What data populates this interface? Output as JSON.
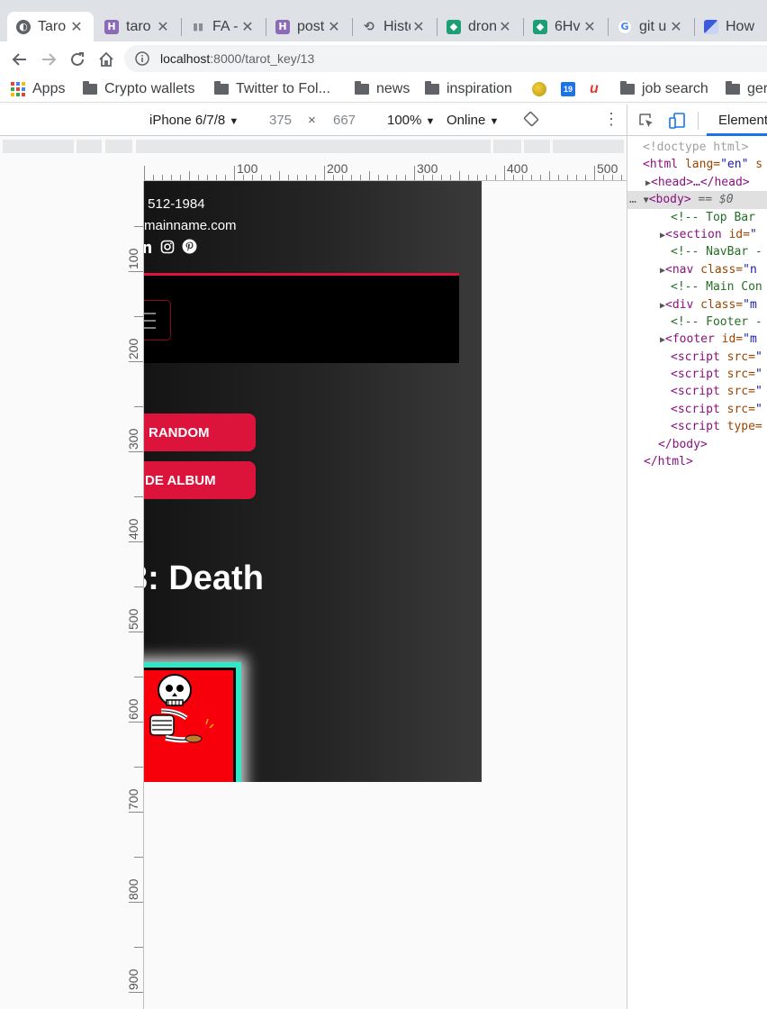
{
  "browser": {
    "tabs": [
      {
        "title": "Taro",
        "active": true,
        "icon": "globe-icon"
      },
      {
        "title": "taro",
        "active": false,
        "icon": "heroku-icon"
      },
      {
        "title": "FA -",
        "active": false,
        "icon": "bars-icon"
      },
      {
        "title": "post",
        "active": false,
        "icon": "heroku-icon"
      },
      {
        "title": "Histo",
        "active": false,
        "icon": "history-icon"
      },
      {
        "title": "dron",
        "active": false,
        "icon": "codepen-icon"
      },
      {
        "title": "6Hv",
        "active": false,
        "icon": "codepen-icon"
      },
      {
        "title": "git u",
        "active": false,
        "icon": "google-icon"
      },
      {
        "title": "How",
        "active": false,
        "icon": "bookmark-icon"
      }
    ],
    "url_host": "localhost",
    "url_path": ":8000/tarot_key/13",
    "bookmarks": [
      {
        "label": "Apps",
        "icon": "apps-icon"
      },
      {
        "label": "Crypto wallets",
        "icon": "folder-icon"
      },
      {
        "label": "Twitter to Fol...",
        "icon": "folder-icon"
      },
      {
        "label": "news",
        "icon": "folder-icon"
      },
      {
        "label": "inspiration",
        "icon": "folder-icon"
      },
      {
        "label": "",
        "icon": "ball-icon"
      },
      {
        "label": "",
        "icon": "calendar-icon"
      },
      {
        "label": "",
        "icon": "u-icon"
      },
      {
        "label": "job search",
        "icon": "folder-icon"
      },
      {
        "label": "ger",
        "icon": "folder-icon"
      }
    ]
  },
  "device_toolbar": {
    "device": "iPhone 6/7/8",
    "width": "375",
    "times": "×",
    "height": "667",
    "zoom": "100%",
    "network": "Online"
  },
  "rulers": {
    "top": [
      "100",
      "200",
      "300",
      "400",
      "500"
    ],
    "left": [
      "100",
      "200",
      "300",
      "400",
      "500",
      "600",
      "700",
      "800",
      "900"
    ]
  },
  "page": {
    "phone": ") 512-1984",
    "email": "mainname.com",
    "social_icons": [
      "linkedin-icon",
      "instagram-icon",
      "pinterest-icon"
    ],
    "buttons": [
      "RANDOM",
      "DE ALBUM"
    ],
    "heading": "3: Death",
    "colors": {
      "accent": "#dc143c",
      "card_border": "#2ee8c8",
      "card_bg": "#f8000b"
    }
  },
  "devtools": {
    "active_tab": "Element",
    "dom": [
      {
        "type": "doctype",
        "text": "<!doctype html>"
      },
      {
        "type": "tag",
        "open": "<html",
        "attr": " lang=",
        "val": "\"en\"",
        "rest": " s"
      },
      {
        "type": "collapsed",
        "text": "<head>…</head>"
      },
      {
        "type": "body",
        "text": "<body>",
        "suffix": " == $0"
      },
      {
        "type": "comment",
        "text": "<!-- Top Bar"
      },
      {
        "type": "tag",
        "open": "<section",
        "attr": " id=",
        "val": "\"",
        "rest": ""
      },
      {
        "type": "comment",
        "text": "<!-- NavBar -"
      },
      {
        "type": "tag",
        "open": "<nav",
        "attr": " class=",
        "val": "\"n",
        "rest": ""
      },
      {
        "type": "comment",
        "text": "<!-- Main Con"
      },
      {
        "type": "tag",
        "open": "<div",
        "attr": " class=",
        "val": "\"m",
        "rest": ""
      },
      {
        "type": "comment",
        "text": "<!-- Footer -"
      },
      {
        "type": "tag",
        "open": "<footer",
        "attr": " id=",
        "val": "\"m",
        "rest": ""
      },
      {
        "type": "tag",
        "open": "<script",
        "attr": " src=",
        "val": "\"",
        "rest": ""
      },
      {
        "type": "tag",
        "open": "<script",
        "attr": " src=",
        "val": "\"",
        "rest": ""
      },
      {
        "type": "tag",
        "open": "<script",
        "attr": " src=",
        "val": "\"",
        "rest": ""
      },
      {
        "type": "tag",
        "open": "<script",
        "attr": " src=",
        "val": "\"",
        "rest": ""
      },
      {
        "type": "tag",
        "open": "<script",
        "attr": " type=",
        "val": "",
        "rest": ""
      },
      {
        "type": "close",
        "text": "</body>"
      },
      {
        "type": "close",
        "text": "</html>"
      }
    ]
  }
}
